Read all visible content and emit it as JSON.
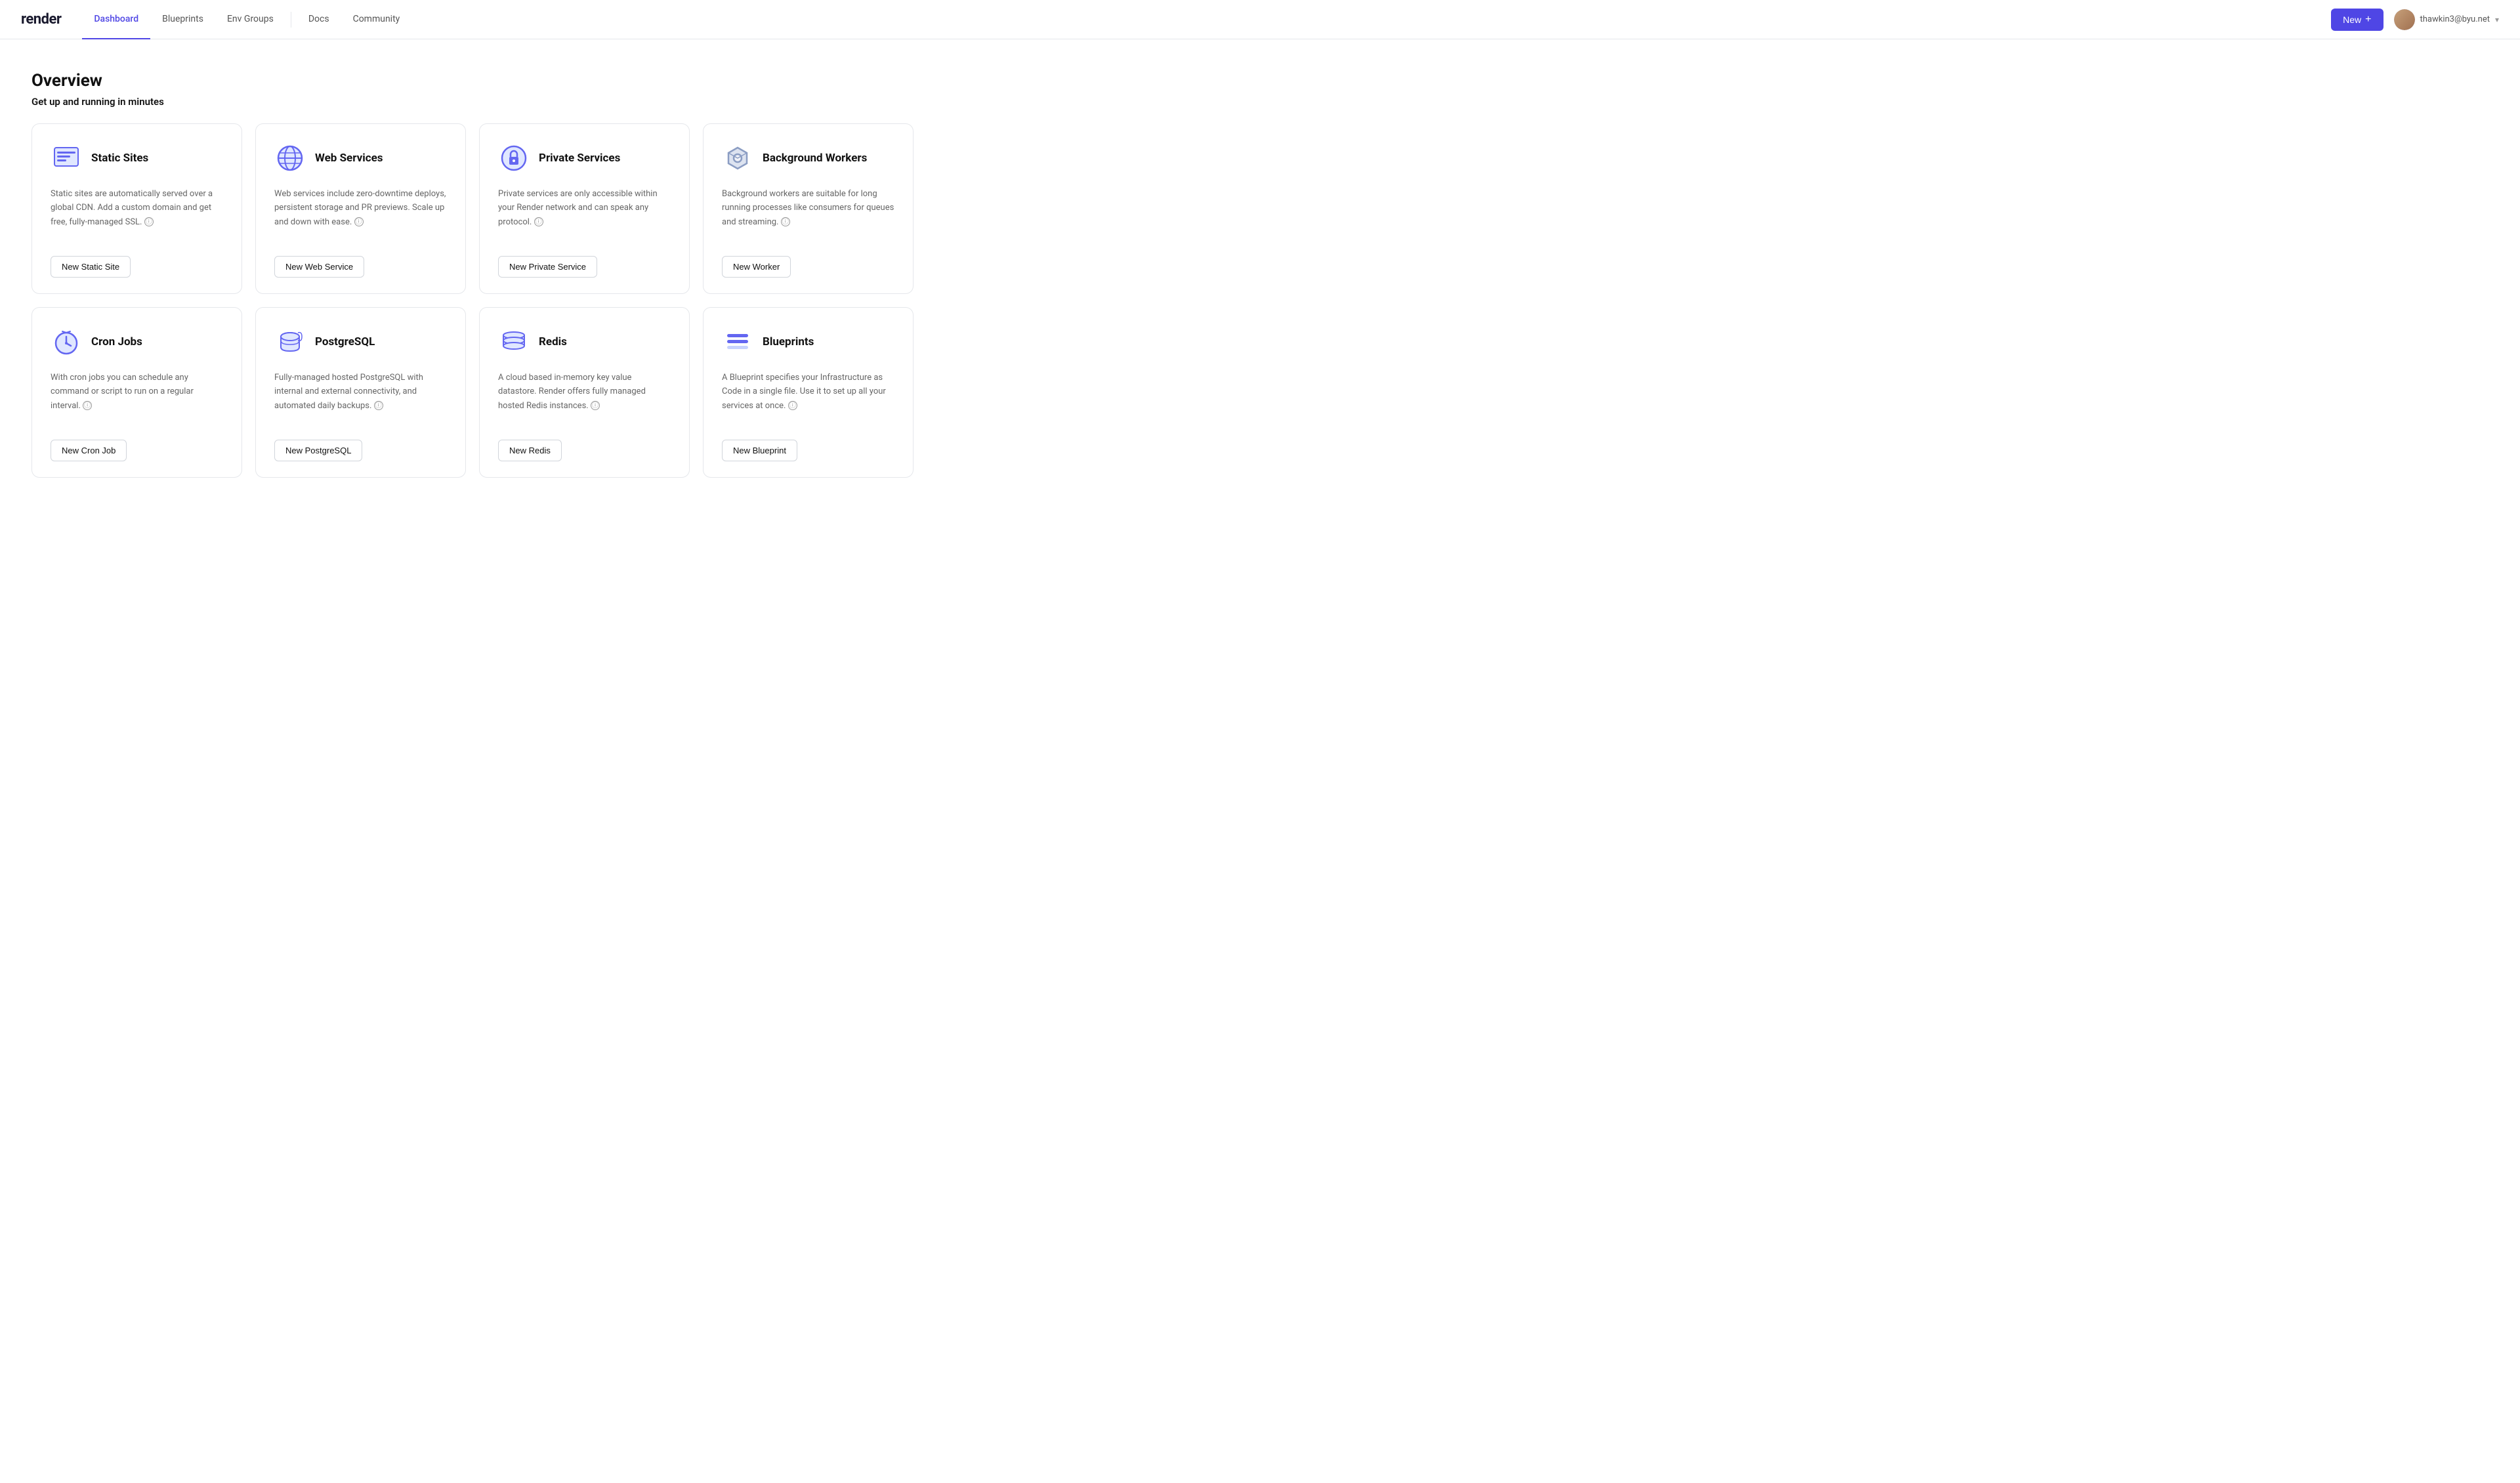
{
  "nav": {
    "logo": "render",
    "links": [
      {
        "id": "dashboard",
        "label": "Dashboard",
        "active": true
      },
      {
        "id": "blueprints",
        "label": "Blueprints",
        "active": false
      },
      {
        "id": "env-groups",
        "label": "Env Groups",
        "active": false
      },
      {
        "id": "docs",
        "label": "Docs",
        "active": false
      },
      {
        "id": "community",
        "label": "Community",
        "active": false
      }
    ],
    "new_button": "New",
    "user_email": "thawkin3@byu.net",
    "chevron": "▾"
  },
  "main": {
    "title": "Overview",
    "subtitle": "Get up and running in minutes",
    "cards": [
      {
        "id": "static-sites",
        "title": "Static Sites",
        "description": "Static sites are automatically served over a global CDN. Add a custom domain and get free, fully-managed SSL.",
        "button_label": "New Static Site",
        "icon": "static"
      },
      {
        "id": "web-services",
        "title": "Web Services",
        "description": "Web services include zero-downtime deploys, persistent storage and PR previews. Scale up and down with ease.",
        "button_label": "New Web Service",
        "icon": "web"
      },
      {
        "id": "private-services",
        "title": "Private Services",
        "description": "Private services are only accessible within your Render network and can speak any protocol.",
        "button_label": "New Private Service",
        "icon": "private"
      },
      {
        "id": "background-workers",
        "title": "Background Workers",
        "description": "Background workers are suitable for long running processes like consumers for queues and streaming.",
        "button_label": "New Worker",
        "icon": "worker"
      },
      {
        "id": "cron-jobs",
        "title": "Cron Jobs",
        "description": "With cron jobs you can schedule any command or script to run on a regular interval.",
        "button_label": "New Cron Job",
        "icon": "cron"
      },
      {
        "id": "postgresql",
        "title": "PostgreSQL",
        "description": "Fully-managed hosted PostgreSQL with internal and external connectivity, and automated daily backups.",
        "button_label": "New PostgreSQL",
        "icon": "postgres"
      },
      {
        "id": "redis",
        "title": "Redis",
        "description": "A cloud based in-memory key value datastore. Render offers fully managed hosted Redis instances.",
        "button_label": "New Redis",
        "icon": "redis"
      },
      {
        "id": "blueprints",
        "title": "Blueprints",
        "description": "A Blueprint specifies your Infrastructure as Code in a single file. Use it to set up all your services at once.",
        "button_label": "New Blueprint",
        "icon": "blueprints"
      }
    ]
  }
}
